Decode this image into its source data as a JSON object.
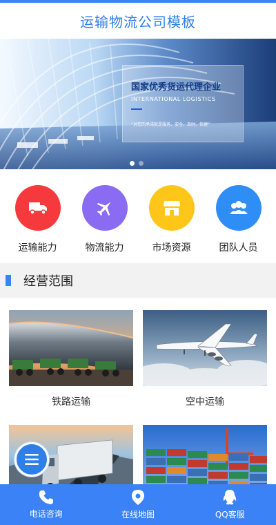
{
  "header": {
    "title": "运输物流公司模板"
  },
  "banner": {
    "headline": "国家优秀货运代理企业",
    "subtitle": "INTERNATIONAL LOGISTICS",
    "description": "“对您的承诺就是服务、安全、及时、快捷”",
    "slide_count": 2,
    "active_slide": 1
  },
  "feature_icons": [
    {
      "label": "运输能力",
      "icon": "truck-icon",
      "color": "#f5393c"
    },
    {
      "label": "物流能力",
      "icon": "airplane-icon",
      "color": "#8a6cf2"
    },
    {
      "label": "市场资源",
      "icon": "store-icon",
      "color": "#ffc61a"
    },
    {
      "label": "团队人员",
      "icon": "team-icon",
      "color": "#2f8ef5"
    }
  ],
  "section": {
    "title": "经营范围"
  },
  "services": [
    {
      "label": "铁路运输",
      "image": "railway-tanker-train-photo"
    },
    {
      "label": "空中运输",
      "image": "airplane-photo"
    },
    {
      "label": "",
      "image": "truck-highway-photo"
    },
    {
      "label": "",
      "image": "container-port-photo"
    }
  ],
  "fab": {
    "icon": "menu-icon"
  },
  "bottom_nav": [
    {
      "label": "电话咨询",
      "icon": "phone-icon"
    },
    {
      "label": "在线地图",
      "icon": "map-pin-icon"
    },
    {
      "label": "QQ客服",
      "icon": "qq-icon"
    }
  ],
  "colors": {
    "primary": "#3b82f6",
    "header_text": "#2f7fe8",
    "section_bg": "#f2f2f2"
  }
}
